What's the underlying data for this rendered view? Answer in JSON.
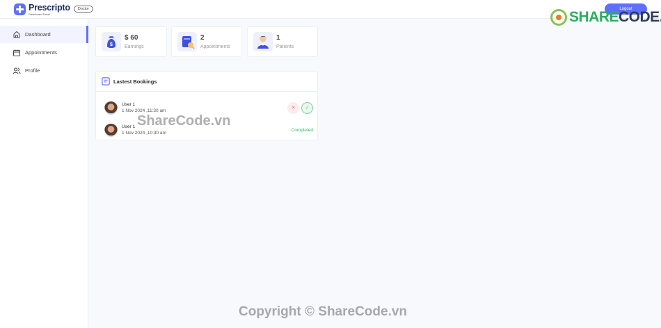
{
  "header": {
    "brand": "Prescripto",
    "brand_sub": "Dashboard Panel",
    "role_badge": "Doctor",
    "logout_label": "Logout"
  },
  "watermarks": {
    "top_logo": "SHARECODE.vn",
    "middle": "ShareCode.vn",
    "bottom": "Copyright © ShareCode.vn"
  },
  "sidebar": {
    "items": [
      {
        "label": "Dashboard",
        "icon": "home-icon",
        "active": true
      },
      {
        "label": "Appointments",
        "icon": "calendar-icon",
        "active": false
      },
      {
        "label": "Profile",
        "icon": "people-icon",
        "active": false
      }
    ]
  },
  "stats": [
    {
      "value": "$ 60",
      "label": "Earnings",
      "icon": "money-bag-icon"
    },
    {
      "value": "2",
      "label": "Appointments",
      "icon": "appointments-icon"
    },
    {
      "value": "1",
      "label": "Patients",
      "icon": "patient-icon"
    }
  ],
  "bookings": {
    "title": "Lastest Bookings",
    "rows": [
      {
        "name": "User 1",
        "date": "1 Nov 2024 ,11:30 am",
        "status": "pending"
      },
      {
        "name": "User 1",
        "date": "1 Nov 2024 ,10:30 am",
        "status": "Completed"
      }
    ]
  },
  "colors": {
    "accent": "#5f6fff",
    "completed": "#22c55e",
    "cancel": "#e57373"
  }
}
